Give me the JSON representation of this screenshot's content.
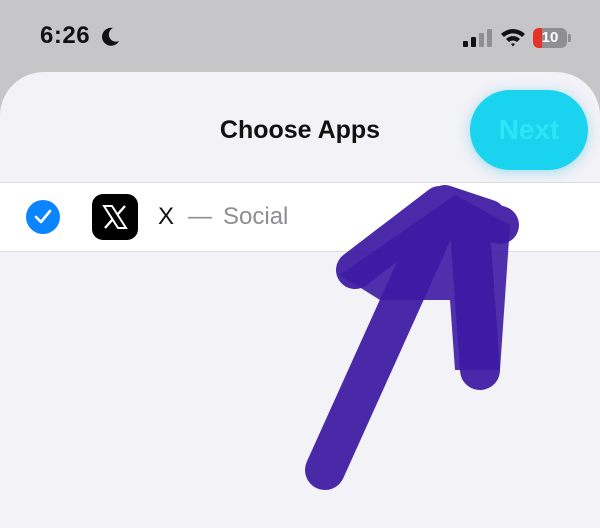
{
  "status_bar": {
    "time": "6:26",
    "battery_level": "10",
    "battery_fraction": 0.1,
    "icons": [
      "moon-icon",
      "signal-icon",
      "wifi-icon",
      "battery-icon"
    ]
  },
  "sheet": {
    "title": "Choose Apps",
    "next_label": "Next"
  },
  "apps": [
    {
      "name": "X",
      "separator": "—",
      "category": "Social",
      "selected": true,
      "icon": "x-logo-icon"
    }
  ],
  "annotation": {
    "icon": "arrow-up-right-icon",
    "color": "#3d1aa3"
  },
  "colors": {
    "next_button": "#1ad4ef",
    "check": "#0a84ff",
    "battery_low": "#e5332a"
  }
}
